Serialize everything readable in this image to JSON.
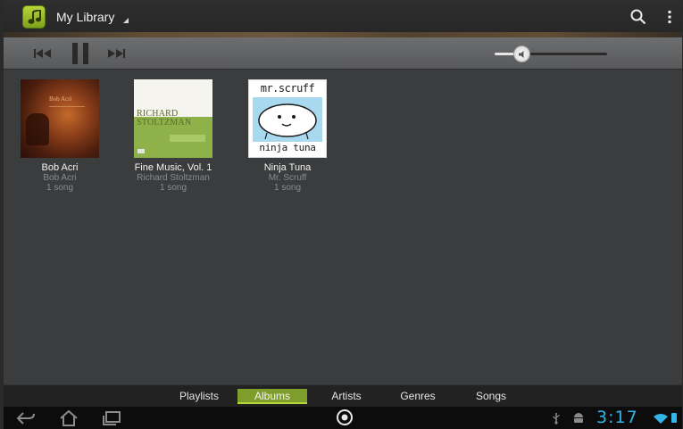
{
  "action_bar": {
    "title": "My Library",
    "app_icon": "music-note-icon",
    "actions": [
      "search-icon",
      "overflow-menu-icon"
    ]
  },
  "transport": {
    "controls": [
      "previous-track-icon",
      "pause-icon",
      "next-track-icon"
    ],
    "volume_level": 0.24
  },
  "albums": [
    {
      "name": "Bob Acri",
      "artist": "Bob Acri",
      "count": "1 song",
      "cover_text": "Bob Acri"
    },
    {
      "name": "Fine Music, Vol. 1",
      "artist": "Richard Stoltzman",
      "count": "1 song",
      "cover_title": "RICHARD STOLTZMAN"
    },
    {
      "name": "Ninja Tuna",
      "artist": "Mr. Scruff",
      "count": "1 song",
      "cover_title": "mr.scruff",
      "cover_subtitle": "ninja tuna"
    }
  ],
  "tabs": [
    {
      "label": "Playlists",
      "active": false
    },
    {
      "label": "Albums",
      "active": true
    },
    {
      "label": "Artists",
      "active": false
    },
    {
      "label": "Genres",
      "active": false
    },
    {
      "label": "Songs",
      "active": false
    }
  ],
  "system_bar": {
    "clock": "3:17",
    "accent_color": "#33b5e5"
  },
  "colors": {
    "tab_active": "#7f9d2a",
    "app_icon": "#9dbf2c"
  }
}
